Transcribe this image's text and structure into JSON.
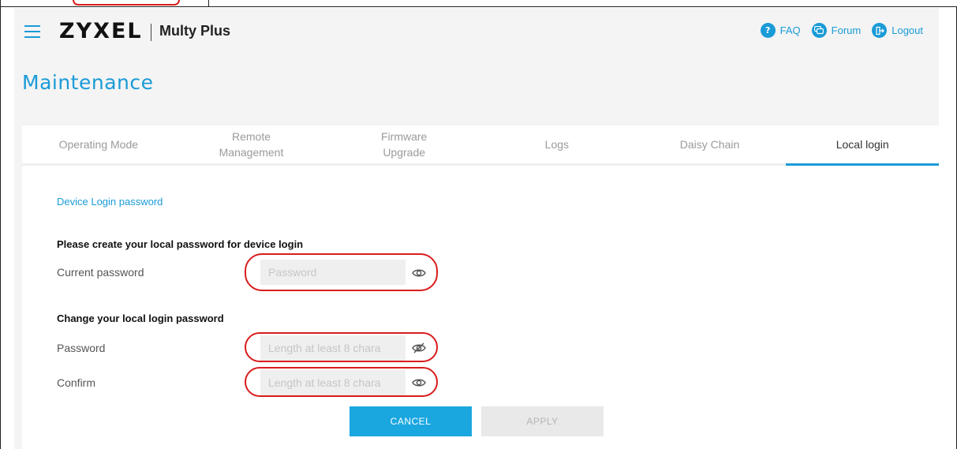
{
  "header": {
    "brand": "ZYXEL",
    "product": "Multy Plus",
    "links": [
      {
        "label": "FAQ",
        "icon": "faq-icon"
      },
      {
        "label": "Forum",
        "icon": "forum-icon"
      },
      {
        "label": "Logout",
        "icon": "logout-icon"
      }
    ]
  },
  "page": {
    "title": "Maintenance"
  },
  "tabs": [
    {
      "line1": "Operating Mode",
      "line2": ""
    },
    {
      "line1": "Remote",
      "line2": "Management"
    },
    {
      "line1": "Firmware",
      "line2": "Upgrade"
    },
    {
      "line1": "Logs",
      "line2": ""
    },
    {
      "line1": "Daisy Chain",
      "line2": ""
    },
    {
      "line1": "Local login",
      "line2": ""
    }
  ],
  "active_tab": "Local login",
  "form": {
    "section_title": "Device Login password",
    "create_heading": "Please create your local password for device login",
    "current_label": "Current password",
    "current_placeholder": "Password",
    "change_heading": "Change your local login password",
    "password_label": "Password",
    "password_placeholder": "Length at least 8 chara",
    "confirm_label": "Confirm",
    "confirm_placeholder": "Length at least 8 chara"
  },
  "buttons": {
    "cancel": "CANCEL",
    "apply": "APPLY"
  },
  "colors": {
    "accent": "#1a9bd7",
    "highlight": "#d91c1c",
    "cancel_bg": "#1aa7e0"
  }
}
